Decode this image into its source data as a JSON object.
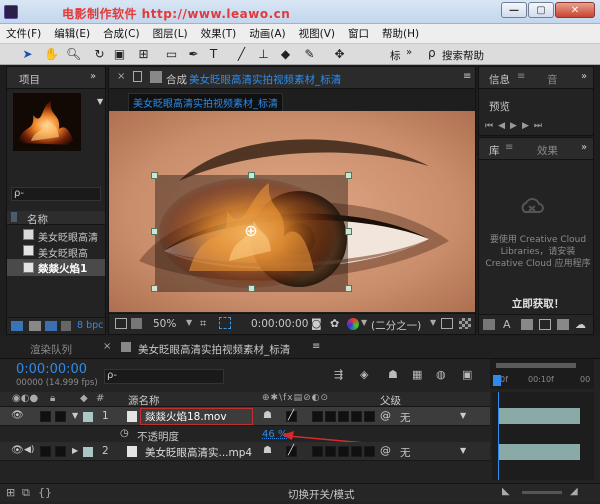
{
  "titlebar": {
    "watermark": "电影制作软件  http://www.leawo.cn"
  },
  "menu": [
    "文件(F)",
    "编辑(E)",
    "合成(C)",
    "图层(L)",
    "效果(T)",
    "动画(A)",
    "视图(V)",
    "窗口",
    "帮助(H)"
  ],
  "toolbar": {
    "label1": "标",
    "label2": "搜索帮助"
  },
  "project": {
    "tab": "项目",
    "search_placeholder": "ρ-",
    "col_name": "名称",
    "items": [
      "美女眨眼高清",
      "美女眨眼高",
      "燚燚火焰1"
    ],
    "bpc": "8 bpc"
  },
  "comp": {
    "tab_prefix": "合成",
    "tab_name": "美女眨眼高清实拍视频素材_标清",
    "crumb": "美女眨眼高清实拍视频素材_标清",
    "zoom": "50%",
    "timecode": "0:00:00:00",
    "resolution": "(二分之一)"
  },
  "info_panel": {
    "tab1": "信息",
    "tab2": "音",
    "preview": "预览"
  },
  "library": {
    "tab1": "库",
    "tab2": "效果",
    "message": "要使用 Creative Cloud Libraries，请安装 Creative Cloud 应用程序",
    "install": "立即获取！"
  },
  "bottom_tabs": {
    "render": "渲染队列",
    "timeline": "美女眨眼高清实拍视频素材_标清"
  },
  "timeline": {
    "timecode": "0:00:00:00",
    "fps": "00000 (14.999 fps)",
    "search_placeholder": "ρ-",
    "col_source": "源名称",
    "col_parent": "父级",
    "ruler": [
      "0f",
      "00:10f",
      "00"
    ],
    "layers": [
      {
        "num": "1",
        "name": "燚燚火焰18.mov",
        "parent": "无",
        "chip": "#a9c7c4"
      },
      {
        "num": "2",
        "name": "美女眨眼高清实...mp4",
        "parent": "无",
        "chip": "#a9c7c4"
      }
    ],
    "opacity_label": "不透明度",
    "opacity_value": "46 %",
    "footer": "切换开关/模式"
  }
}
